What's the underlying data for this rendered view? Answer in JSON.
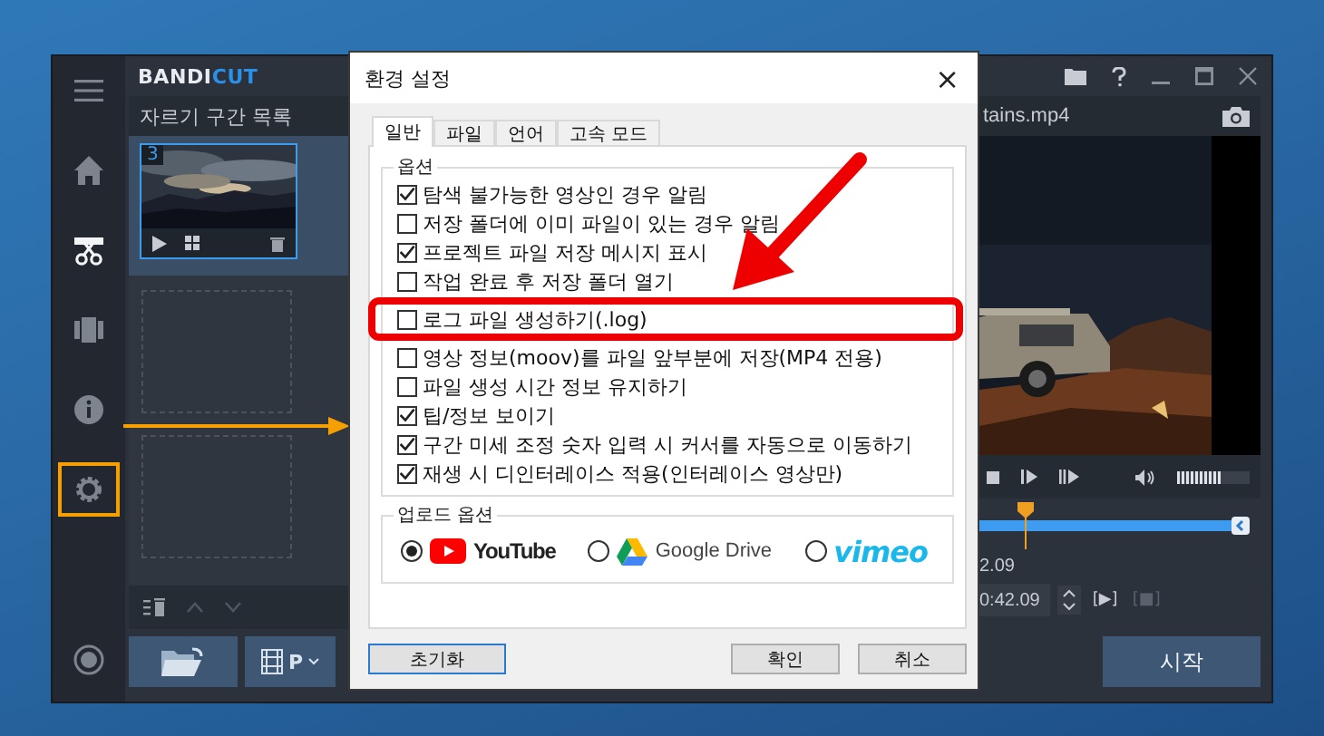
{
  "app": {
    "logo_primary": "BANDI",
    "logo_accent": "CUT",
    "sidebar": [
      {
        "kind": "menu",
        "selected": false,
        "highlighted": false
      },
      {
        "kind": "home",
        "selected": false,
        "highlighted": false
      },
      {
        "kind": "cut",
        "selected": true,
        "highlighted": false
      },
      {
        "kind": "film",
        "selected": false,
        "highlighted": false
      },
      {
        "kind": "info",
        "selected": false,
        "highlighted": false
      },
      {
        "kind": "settings",
        "selected": false,
        "highlighted": true
      },
      {
        "kind": "record",
        "selected": false,
        "highlighted": false
      }
    ],
    "segment_list": {
      "title": "자르기 구간 목록",
      "segments": [
        {
          "number": "3",
          "selected": true
        }
      ]
    },
    "export_label": "P",
    "file_name": "tains.mp4",
    "volume": {
      "level": 0.6
    },
    "time_start": "2.09",
    "time_field": "0:42.09",
    "mark_buttons": [
      {
        "label": "[▶]",
        "disabled": false
      },
      {
        "label": "[■]",
        "disabled": true
      }
    ],
    "start_button": "시작"
  },
  "dialog": {
    "title": "환경 설정",
    "close": "×",
    "tabs": [
      {
        "label": "일반",
        "selected": true
      },
      {
        "label": "파일",
        "selected": false
      },
      {
        "label": "언어",
        "selected": false
      },
      {
        "label": "고속 모드",
        "selected": false
      }
    ],
    "options_group": "옵션",
    "options": [
      {
        "label": "탐색 불가능한 영상인 경우 알림",
        "checked": true,
        "highlighted": false
      },
      {
        "label": "저장 폴더에 이미 파일이 있는 경우 알림",
        "checked": false,
        "highlighted": false
      },
      {
        "label": "프로젝트 파일 저장 메시지 표시",
        "checked": true,
        "highlighted": false
      },
      {
        "label": "작업 완료 후 저장 폴더 열기",
        "checked": false,
        "highlighted": false
      },
      {
        "label": "로그 파일 생성하기(.log)",
        "checked": false,
        "highlighted": true
      },
      {
        "label": "영상 정보(moov)를 파일 앞부분에 저장(MP4 전용)",
        "checked": false,
        "highlighted": false
      },
      {
        "label": "파일 생성 시간 정보 유지하기",
        "checked": false,
        "highlighted": false
      },
      {
        "label": "팁/정보 보이기",
        "checked": true,
        "highlighted": false
      },
      {
        "label": "구간 미세 조정 숫자 입력 시 커서를 자동으로 이동하기",
        "checked": true,
        "highlighted": false
      },
      {
        "label": "재생 시 디인터레이스 적용(인터레이스 영상만)",
        "checked": true,
        "highlighted": false
      }
    ],
    "upload_group": "업로드 옵션",
    "upload_targets": [
      {
        "kind": "youtube",
        "label": "YouTube",
        "selected": true
      },
      {
        "kind": "gdrive",
        "label": "Google Drive",
        "selected": false
      },
      {
        "kind": "vimeo",
        "label": "vimeo",
        "selected": false
      }
    ],
    "buttons": [
      {
        "kind": "reset",
        "label": "초기화"
      },
      {
        "kind": "ok",
        "label": "확인"
      },
      {
        "kind": "cancel",
        "label": "취소"
      }
    ]
  }
}
